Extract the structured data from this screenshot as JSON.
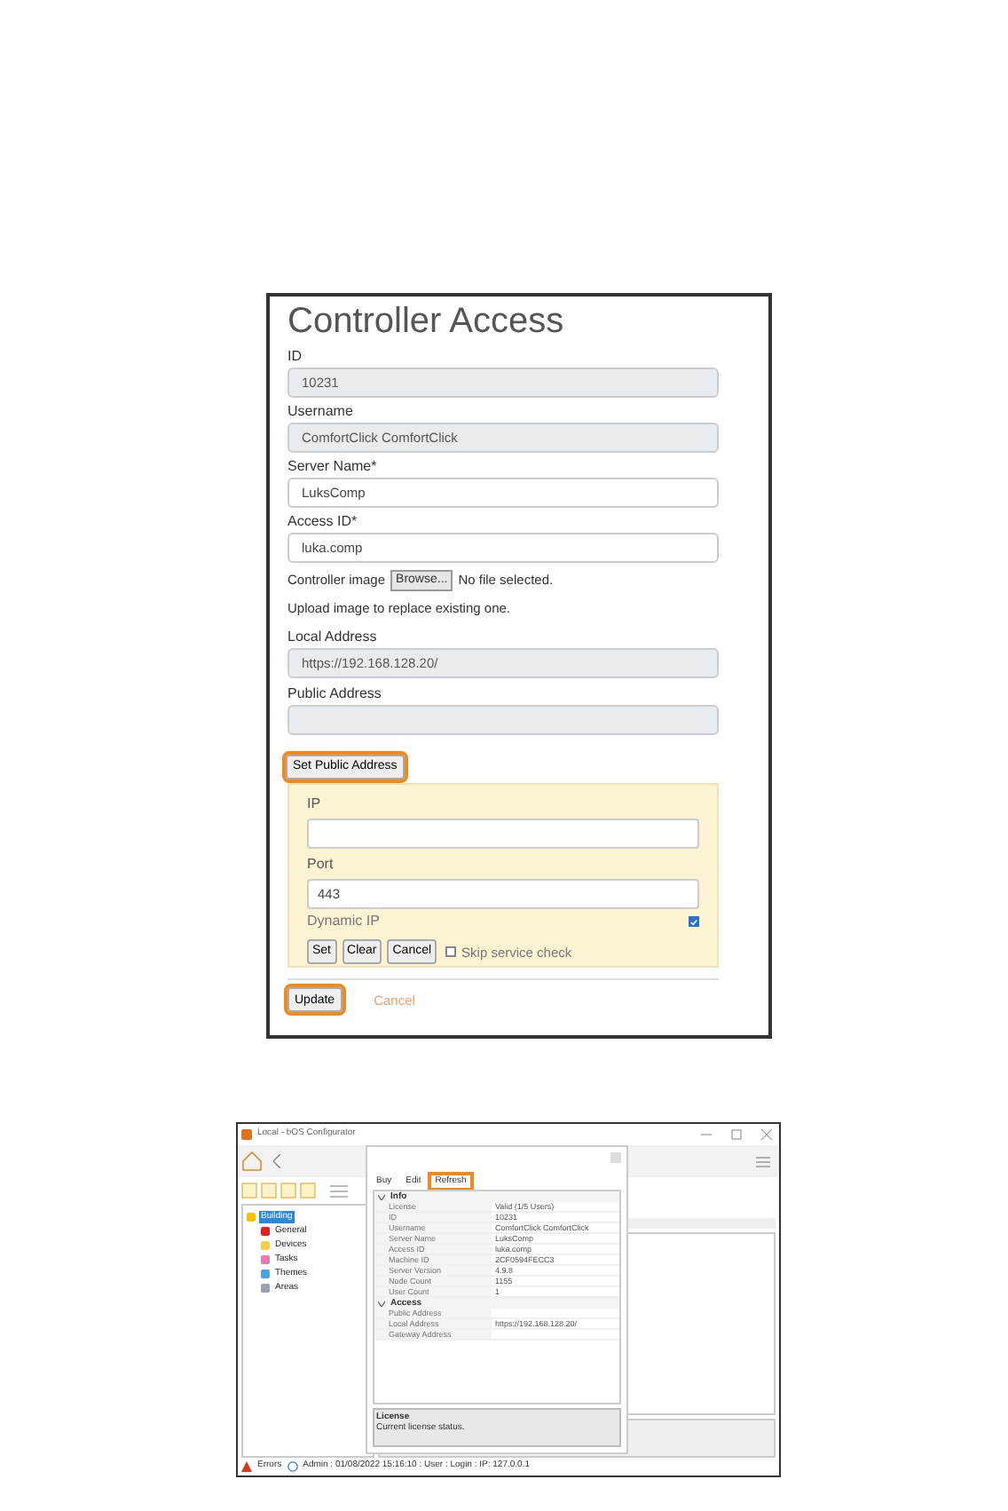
{
  "controller_access": {
    "title": "Controller Access",
    "fields": [
      {
        "label": "ID",
        "value": "10231",
        "disabled": true
      },
      {
        "label": "Username",
        "value": "ComfortClick ComfortClick",
        "disabled": true
      },
      {
        "label": "Server Name*",
        "value": "LuksComp",
        "disabled": false
      },
      {
        "label": "Access ID*",
        "value": "luka.comp",
        "disabled": false
      }
    ],
    "image_label": "Controller image",
    "browse_button": "Browse...",
    "file_status": "No file selected.",
    "upload_hint": "Upload image to replace existing one.",
    "address_fields": [
      {
        "label": "Local Address",
        "value": "https://192.168.128.20/",
        "disabled": true
      },
      {
        "label": "Public Address",
        "disabled": true
      }
    ],
    "set_public_button": {
      "label": "Set Public Address",
      "highlighted": true
    },
    "public_panel": {
      "ip": {
        "label": "IP"
      },
      "port": {
        "label": "Port",
        "value": "443"
      },
      "dynamic_ip": {
        "label": "Dynamic IP",
        "checked": true
      },
      "buttons": [
        "Set",
        "Clear",
        "Cancel"
      ],
      "skip_check": {
        "label": "Skip service check",
        "checked": false
      }
    },
    "update_button": {
      "label": "Update",
      "highlighted": true
    },
    "cancel_link": "Cancel"
  },
  "configurator": {
    "title": "Local - bOS Configurator",
    "tree": [
      {
        "label": "Building",
        "selected": true,
        "color": "#f5c400",
        "children": [
          {
            "label": "General",
            "selected": false,
            "color": "#e02020"
          },
          {
            "label": "Devices",
            "selected": false,
            "color": "#f2d24a"
          },
          {
            "label": "Tasks",
            "selected": false,
            "color": "#e879b8"
          },
          {
            "label": "Themes",
            "selected": false,
            "color": "#4aa3df"
          },
          {
            "label": "Areas",
            "selected": false,
            "color": "#9aa0b0"
          }
        ]
      }
    ],
    "dialog": {
      "toolbar": [
        {
          "label": "Buy",
          "highlighted": false
        },
        {
          "label": "Edit",
          "highlighted": false
        },
        {
          "label": "Refresh",
          "highlighted": true
        }
      ],
      "sections": [
        {
          "title": "Info",
          "expanded": true,
          "rows": [
            {
              "name": "License",
              "value": "Valid (1/5 Users)"
            },
            {
              "name": "ID",
              "value": "10231"
            },
            {
              "name": "Username",
              "value": "ComfortClick ComfortClick"
            },
            {
              "name": "Server Name",
              "value": "LuksComp"
            },
            {
              "name": "Access ID",
              "value": "luka.comp"
            },
            {
              "name": "Machine ID",
              "value": "2CF0594FECC3"
            },
            {
              "name": "Server Version",
              "value": "4.9.8"
            },
            {
              "name": "Node Count",
              "value": "1155"
            },
            {
              "name": "User Count",
              "value": "1"
            }
          ]
        },
        {
          "title": "Access",
          "expanded": true,
          "rows": [
            {
              "name": "Public Address"
            },
            {
              "name": "Local Address",
              "value": "https://192.168.128.20/"
            },
            {
              "name": "Gateway Address"
            }
          ]
        }
      ],
      "description": {
        "title": "License",
        "text": "Current license status."
      }
    },
    "status_bar": {
      "errors": "Errors",
      "info": "Admin : 01/08/2022 15:16:10 : User : Login : IP: 127.0.0.1"
    }
  }
}
